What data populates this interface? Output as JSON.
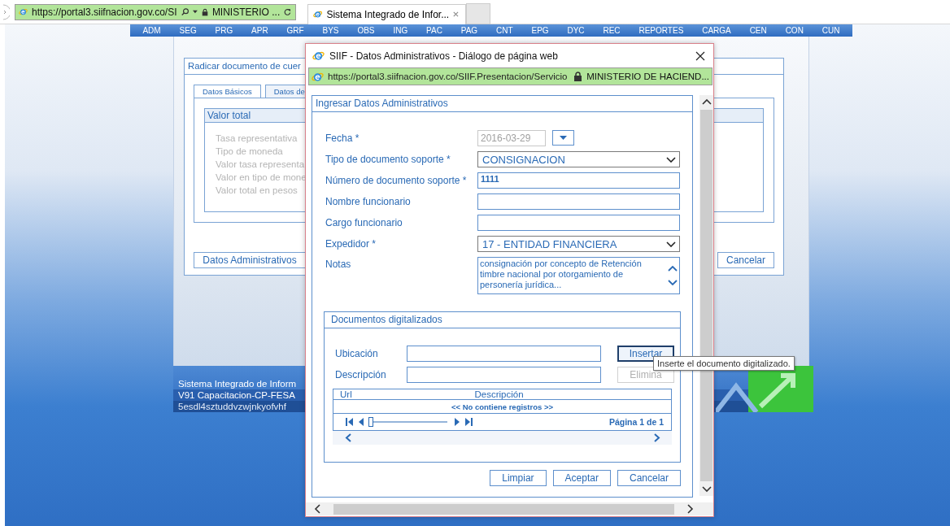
{
  "browser": {
    "address": "https://portal3.siifnacion.gov.co/SI",
    "site_identity": "MINISTERIO ...",
    "tabs": [
      {
        "title": "Sistema Integrado de Infor...",
        "selected": true
      }
    ]
  },
  "menu": [
    "ADM",
    "SEG",
    "PRG",
    "APR",
    "GRF",
    "BYS",
    "OBS",
    "ING",
    "PAC",
    "PAG",
    "CNT",
    "EPG",
    "DYC",
    "REC",
    "REPORTES",
    "CARGA",
    "CEN",
    "CON",
    "CUN"
  ],
  "background_page": {
    "title": "Radicar documento de cuer",
    "tabs": [
      {
        "label": "Datos Básicos",
        "selected": true
      },
      {
        "label": "Datos de",
        "selected": false
      }
    ],
    "section_title": "Valor total",
    "fields": [
      {
        "label": "Tasa representativa",
        "disabled": true
      },
      {
        "label": "Tipo de moneda",
        "disabled": true
      },
      {
        "label": "Valor tasa representa",
        "disabled": true
      },
      {
        "label": "Valor en tipo de mone",
        "disabled": true
      },
      {
        "label": "Valor total en pesos",
        "disabled": true
      }
    ],
    "buttons": [
      "Datos Administrativos",
      "Cancelar"
    ],
    "footer": [
      "Sistema Integrado de Inform",
      "V91 Capacitacion-CP-FESA",
      "5esdl4sztuddvzwjnkyofvhf"
    ]
  },
  "dialog": {
    "title": "SIIF - Datos Administrativos - Diálogo de página web",
    "address": "https://portal3.siifnacion.gov.co/SIIF.Presentacion/Servicio",
    "site_identity": "MINISTERIO DE HACIEND...",
    "panel_title": "Ingresar Datos Administrativos",
    "fields": [
      {
        "kind": "date",
        "label": "Fecha *",
        "value": "2016-03-29",
        "disabled": true
      },
      {
        "kind": "select",
        "label": "Tipo de documento soporte *",
        "value": "CONSIGNACION"
      },
      {
        "kind": "text",
        "label": "Número de documento soporte *",
        "value": "1111"
      },
      {
        "kind": "text",
        "label": "Nombre funcionario"
      },
      {
        "kind": "text",
        "label": "Cargo funcionario"
      },
      {
        "kind": "select",
        "label": "Expedidor *",
        "value": "17 - ENTIDAD FINANCIERA"
      },
      {
        "kind": "textarea",
        "label": "Notas",
        "value": "consignación por concepto de Retención timbre nacional por otorgamiento de personería jurídica..."
      }
    ],
    "documents": {
      "title": "Documentos digitalizados",
      "fields": [
        {
          "label": "Ubicación",
          "button": {
            "label": "Insertar",
            "disabled": false,
            "focused": true
          }
        },
        {
          "label": "Descripción",
          "button": {
            "label": "Elimina",
            "disabled": true,
            "focused": false
          }
        }
      ],
      "tooltip": "Inserte el documento digitalizado.",
      "grid": {
        "columns": [
          "Url",
          "Descripción"
        ],
        "empty_message": "<< No contiene registros >>",
        "page_info": "Página 1 de 1",
        "page_slider": {
          "level": 0
        }
      }
    },
    "buttons": [
      "Limpiar",
      "Aceptar",
      "Cancelar"
    ]
  }
}
